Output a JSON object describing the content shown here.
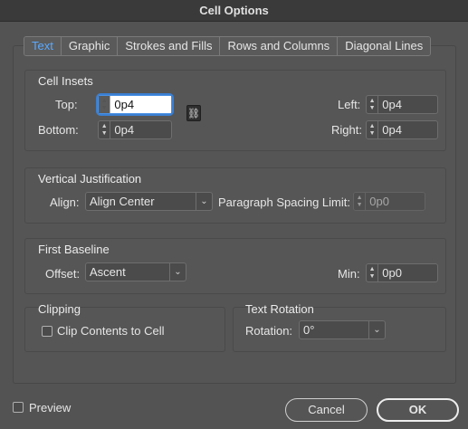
{
  "window": {
    "title": "Cell Options"
  },
  "tabs": [
    "Text",
    "Graphic",
    "Strokes and Fills",
    "Rows and Columns",
    "Diagonal Lines"
  ],
  "cell_insets": {
    "title": "Cell Insets",
    "top_label": "Top:",
    "top_value": "0p4",
    "bottom_label": "Bottom:",
    "bottom_value": "0p4",
    "left_label": "Left:",
    "left_value": "0p4",
    "right_label": "Right:",
    "right_value": "0p4"
  },
  "vertical_justification": {
    "title": "Vertical Justification",
    "align_label": "Align:",
    "align_value": "Align Center",
    "psl_label": "Paragraph Spacing Limit:",
    "psl_value": "0p0"
  },
  "first_baseline": {
    "title": "First Baseline",
    "offset_label": "Offset:",
    "offset_value": "Ascent",
    "min_label": "Min:",
    "min_value": "0p0"
  },
  "clipping": {
    "title": "Clipping",
    "checkbox_label": "Clip Contents to Cell"
  },
  "text_rotation": {
    "title": "Text Rotation",
    "rotation_label": "Rotation:",
    "rotation_value": "0°"
  },
  "footer": {
    "preview_label": "Preview",
    "cancel_label": "Cancel",
    "ok_label": "OK"
  },
  "icons": {
    "link": "chain-link-icon",
    "spinner": "up-down-stepper-icon",
    "dropdown": "chevron-down-icon"
  },
  "colors": {
    "active_tab": "#5aa9ff",
    "background": "#535353",
    "focus": "#3b7fd1"
  }
}
